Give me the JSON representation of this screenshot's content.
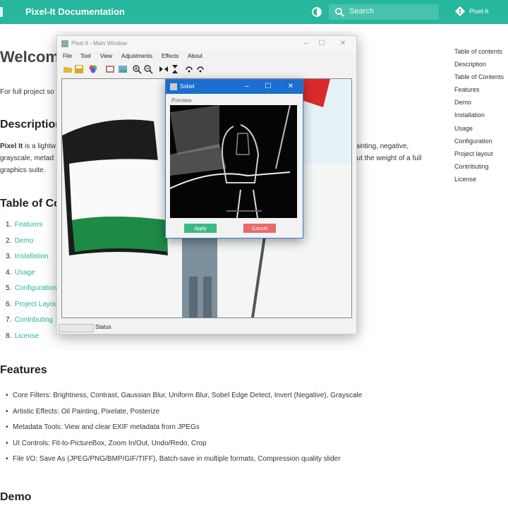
{
  "header": {
    "site_title": "Pixel-It Documentation",
    "search_placeholder": "Search",
    "repo_label": "Pixel-It",
    "accent_color": "#26b79e"
  },
  "doc": {
    "welcome_heading": "Welcome",
    "intro_partial": "For full project so",
    "description_heading": "Description",
    "desc_line1_start": "Pixel It",
    "desc_line1_mid": " is a lightw",
    "desc_line1_end": "painting, negative,",
    "desc_line2_start": "grayscale, metad",
    "desc_line2_end": "out the weight of a full",
    "desc_line3": "graphics suite.",
    "toc_heading": "Table of Co",
    "toc_list": [
      {
        "num": "1.",
        "label": "Features"
      },
      {
        "num": "2.",
        "label": "Demo"
      },
      {
        "num": "3.",
        "label": "Installation"
      },
      {
        "num": "4.",
        "label": "Usage"
      },
      {
        "num": "5.",
        "label": "Configuration"
      },
      {
        "num": "6.",
        "label": "Project Layout"
      },
      {
        "num": "7.",
        "label": "Contributing"
      },
      {
        "num": "8.",
        "label": "License"
      }
    ],
    "features_heading": "Features",
    "features": [
      "Core Filters: Brightness, Contrast, Gaussian Blur, Uniform Blur, Sobel Edge Detect, Invert (Negative), Grayscale",
      "Artistic Effects: Oil Painting, Pixelate, Posterize",
      "Metadata Tools: View and clear EXIF metadata from JPEGs",
      "UI Controls: Fit-to-PictureBox, Zoom In/Out, Undo/Redo, Crop",
      "File I/O: Save As (JPEG/PNG/BMP/GIF/TIFF), Batch-save in multiple formats, Compression quality slider"
    ],
    "demo_heading": "Demo"
  },
  "toc_sidebar": [
    "Table of contents",
    "Description",
    "Table of Contents",
    "Features",
    "Demo",
    "Installation",
    "Usage",
    "Configuration",
    "Project layout",
    "Contributing",
    "License"
  ],
  "main_window": {
    "title": "Pixel It - Main Window",
    "menu": [
      "File",
      "Tool",
      "View",
      "Adjustments",
      "Effects",
      "About"
    ],
    "status": "Status"
  },
  "sobel_dialog": {
    "title": "Sobel",
    "preview_label": "Preview",
    "apply_label": "Apply",
    "cancel_label": "Cancel"
  }
}
